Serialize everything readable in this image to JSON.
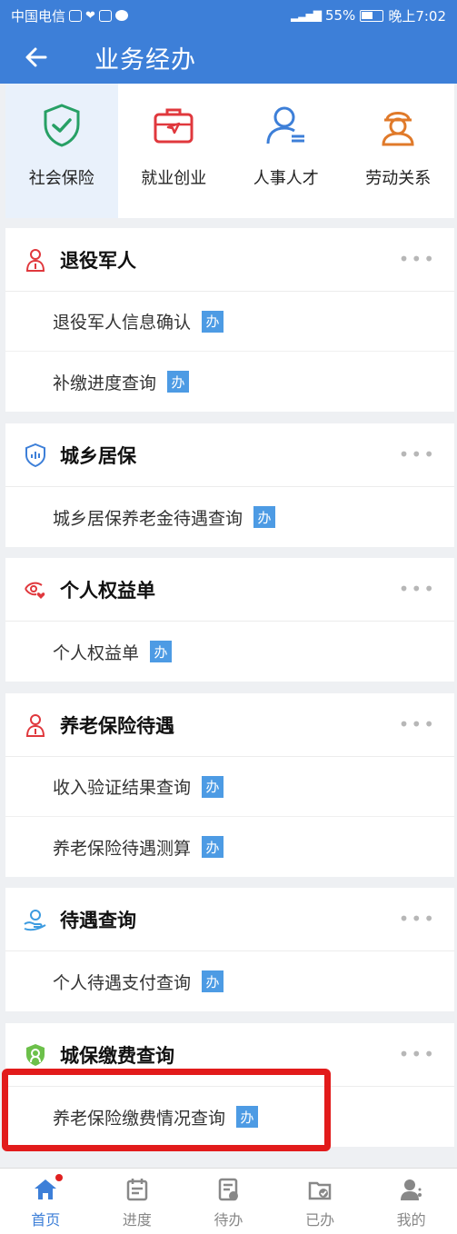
{
  "status": {
    "carrier": "中国电信",
    "battery": "55%",
    "time": "晚上7:02"
  },
  "appbar": {
    "title": "业务经办"
  },
  "categories": [
    {
      "label": "社会保险",
      "icon": "shield-check-icon",
      "color": "#27a065"
    },
    {
      "label": "就业创业",
      "icon": "briefcase-icon",
      "color": "#e0383d"
    },
    {
      "label": "人事人才",
      "icon": "person-doc-icon",
      "color": "#3d7fd8"
    },
    {
      "label": "劳动关系",
      "icon": "worker-icon",
      "color": "#e07a2a"
    }
  ],
  "sections": [
    {
      "title": "退役军人",
      "icon": "veteran-icon",
      "items": [
        "退役军人信息确认",
        "补缴进度查询"
      ]
    },
    {
      "title": "城乡居保",
      "icon": "shield-chart-icon",
      "items": [
        "城乡居保养老金待遇查询"
      ]
    },
    {
      "title": "个人权益单",
      "icon": "eye-heart-icon",
      "items": [
        "个人权益单"
      ]
    },
    {
      "title": "养老保险待遇",
      "icon": "veteran-icon",
      "items": [
        "收入验证结果查询",
        "养老保险待遇测算"
      ]
    },
    {
      "title": "待遇查询",
      "icon": "hand-care-icon",
      "items": [
        "个人待遇支付查询"
      ]
    },
    {
      "title": "城保缴费查询",
      "icon": "green-shield-icon",
      "items": [
        "养老保险缴费情况查询"
      ]
    }
  ],
  "badge": "办",
  "more": "•••",
  "tabs": [
    {
      "label": "首页"
    },
    {
      "label": "进度"
    },
    {
      "label": "待办"
    },
    {
      "label": "已办"
    },
    {
      "label": "我的"
    }
  ],
  "colors": {
    "primary": "#3d7fd8",
    "badge": "#4d9be4",
    "highlight": "#e21b1b"
  }
}
